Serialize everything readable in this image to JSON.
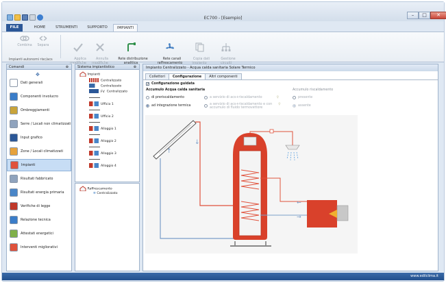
{
  "window": {
    "title": "EC700 - [Esempio]"
  },
  "menu": {
    "tabs": [
      "FILE",
      "HOME",
      "STRUMENTI",
      "SUPPORTO",
      "IMPIANTI"
    ],
    "active": "IMPIANTI"
  },
  "ribbon": {
    "buttons": [
      {
        "label": "Combina",
        "enabled": false
      },
      {
        "label": "Separa",
        "enabled": false
      },
      {
        "label": "Applica\nmodifiche",
        "enabled": false
      },
      {
        "label": "Annulla\nmodifiche",
        "enabled": false
      },
      {
        "label": "Rete distribuzione\nanalitica",
        "enabled": true
      },
      {
        "label": "Rete canali\nraffrescamento",
        "enabled": true
      },
      {
        "label": "Copia dati\nimpianto",
        "enabled": false
      },
      {
        "label": "Gestione\ncircuiti",
        "enabled": false
      }
    ],
    "group_label": "Impianti autonomi risc/acs"
  },
  "left_panel": {
    "title": "Comandi",
    "items": [
      "Dati generali",
      "Componenti involucro",
      "Ombreggiamenti",
      "Serre / Locali non climatizzati",
      "Input grafico",
      "Zone / Locali climatizzati",
      "Impianti",
      "Risultati fabbricato",
      "Risultati energia primaria",
      "Verifiche di legge",
      "Relazione tecnica",
      "Attestati energetici",
      "Interventi migliorativi"
    ],
    "active_index": 6
  },
  "tree": {
    "title": "Sistema impiantistico",
    "root": "Impianti",
    "children": [
      {
        "label": "Centralizzato",
        "icon": "radiator-icon"
      },
      {
        "label": "Centralizzato",
        "icon": "tap-icon"
      },
      {
        "label": "Centralizzato",
        "icon": "pv-icon",
        "prefix": "FV"
      },
      {
        "label": "Ufficio 1",
        "icon": "unit-icon"
      },
      {
        "label": "Ufficio 2",
        "icon": "unit-icon"
      },
      {
        "label": "Alloggio 1",
        "icon": "unit-icon"
      },
      {
        "label": "Alloggio 2",
        "icon": "unit-icon"
      },
      {
        "label": "Alloggio 3",
        "icon": "unit-icon"
      },
      {
        "label": "Alloggio 4",
        "icon": "unit-icon"
      }
    ],
    "cooling_root": "Raffrescamento",
    "cooling_child": "Centralizzato"
  },
  "content": {
    "header": "Impianto Centralizzato - Acqua calda sanitaria Solare Termico",
    "tabs": [
      "Collettori",
      "Configurazione",
      "Altri componenti"
    ],
    "active_tab": "Configurazione",
    "guided_config_label": "Configurazione guidata",
    "guided_config_checked": true,
    "section_left": "Accumulo Acqua calda sanitaria",
    "section_right": "Accumulo riscaldamento",
    "options": [
      {
        "label": "di preriscaldamento",
        "selected": false,
        "enabled": true
      },
      {
        "label": "ad integrazione termica",
        "selected": true,
        "enabled": true
      },
      {
        "label": "a servizio di acs+riscaldamento",
        "selected": false,
        "enabled": false
      },
      {
        "label": "a servizio di acs+riscaldamento e con\naccumulo di fluido termovettore",
        "selected": false,
        "enabled": false
      },
      {
        "label": "presente",
        "selected": false,
        "enabled": false
      },
      {
        "label": "assente",
        "selected": true,
        "enabled": false
      }
    ]
  },
  "status": {
    "url": "www.edilclima.it"
  },
  "colors": {
    "accent": "#2b5797",
    "tank": "#d9412b",
    "pipe_hot": "#e0523c",
    "pipe_cold": "#7a9ec9"
  }
}
